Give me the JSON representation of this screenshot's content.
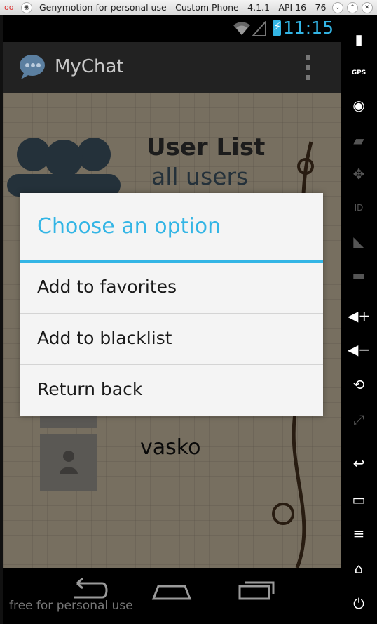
{
  "window": {
    "title": "Genymotion for personal use - Custom Phone - 4.1.1 - API 16 - 76...",
    "menu_glyph": "◉",
    "minimize_glyph": "⌄",
    "maximize_glyph": "^",
    "close_glyph": "✕"
  },
  "status_bar": {
    "time": "11:15"
  },
  "action_bar": {
    "app_title": "MyChat"
  },
  "screen": {
    "header_title": "User List",
    "header_subtitle": "all users",
    "visible_user": "vasko"
  },
  "dialog": {
    "title": "Choose an option",
    "options": [
      "Add to favorites",
      "Add to blacklist",
      "Return back"
    ]
  },
  "watermark": "free for personal use",
  "side_panel": {
    "gps_label": "GPS",
    "id_label": "ID"
  },
  "colors": {
    "accent": "#33b5e5",
    "dialog_bg": "#f4f4f4",
    "paper": "#d9cbb0"
  }
}
